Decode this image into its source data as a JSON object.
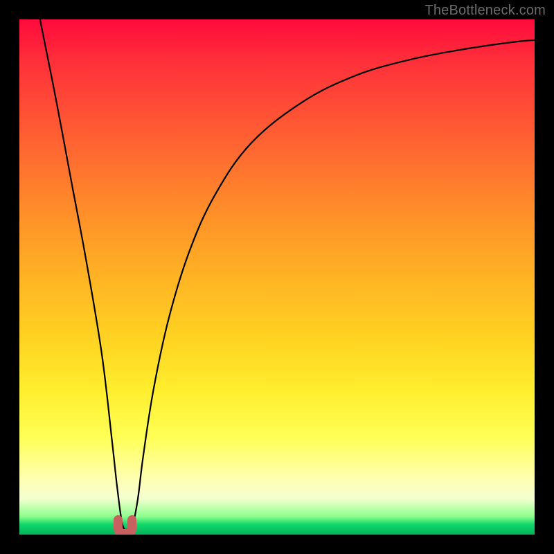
{
  "attribution": "TheBottleneck.com",
  "colors": {
    "background": "#000000",
    "gradient_top": "#ff0a3c",
    "gradient_mid": "#ffd322",
    "gradient_bottom": "#00b35a",
    "curve": "#000000",
    "marker": "#c96060"
  },
  "chart_data": {
    "type": "line",
    "title": "",
    "xlabel": "",
    "ylabel": "",
    "xlim": [
      0,
      100
    ],
    "ylim": [
      0,
      100
    ],
    "grid": false,
    "series": [
      {
        "name": "bottleneck-curve",
        "x": [
          4,
          7,
          10,
          13,
          16,
          18,
          19,
          20,
          21,
          22,
          23,
          24,
          26,
          29,
          33,
          38,
          45,
          55,
          65,
          75,
          85,
          95,
          100
        ],
        "values": [
          100,
          85,
          69,
          53,
          35,
          18,
          9,
          2,
          1,
          2,
          7,
          15,
          28,
          42,
          55,
          66,
          76,
          84,
          89,
          92,
          94,
          95.5,
          96
        ]
      }
    ],
    "annotations": [
      {
        "name": "min-marker",
        "x": 20.5,
        "y": 1,
        "shape": "u",
        "color": "#c96060"
      }
    ]
  }
}
